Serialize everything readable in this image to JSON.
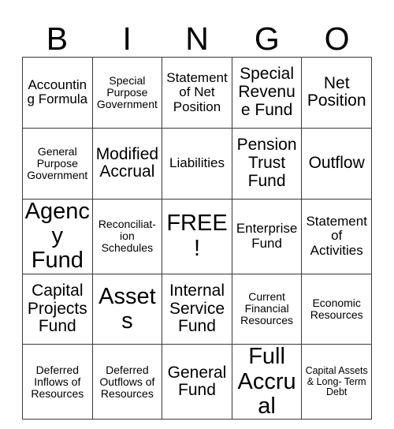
{
  "card": {
    "header_letters": [
      "B",
      "I",
      "N",
      "G",
      "O"
    ],
    "free_space_label": "FREE!",
    "rows": [
      [
        {
          "text": "Accounting Formula",
          "size": "fs-md"
        },
        {
          "text": "Special Purpose Government",
          "size": "fs-sm"
        },
        {
          "text": "Statement of Net Position",
          "size": "fs-md"
        },
        {
          "text": "Special Revenue Fund",
          "size": "fs-lg"
        },
        {
          "text": "Net Position",
          "size": "fs-lg"
        }
      ],
      [
        {
          "text": "General Purpose Government",
          "size": "fs-sm"
        },
        {
          "text": "Modified Accrual",
          "size": "fs-lg"
        },
        {
          "text": "Liabilities",
          "size": "fs-md"
        },
        {
          "text": "Pension Trust Fund",
          "size": "fs-lg"
        },
        {
          "text": "Outflow",
          "size": "fs-lg"
        }
      ],
      [
        {
          "text": "Agency Fund",
          "size": "fs-xl"
        },
        {
          "text": "Reconciliat-\nion\nSchedules",
          "size": "fs-sm"
        },
        {
          "text": "FREE!",
          "size": "fs-xl"
        },
        {
          "text": "Enterprise Fund",
          "size": "fs-md"
        },
        {
          "text": "Statement of Activities",
          "size": "fs-md"
        }
      ],
      [
        {
          "text": "Capital Projects Fund",
          "size": "fs-lg"
        },
        {
          "text": "Assets",
          "size": "fs-xl"
        },
        {
          "text": "Internal Service Fund",
          "size": "fs-lg"
        },
        {
          "text": "Current Financial Resources",
          "size": "fs-sm"
        },
        {
          "text": "Economic Resources",
          "size": "fs-sm"
        }
      ],
      [
        {
          "text": "Deferred Inflows of Resources",
          "size": "fs-sm"
        },
        {
          "text": "Deferred Outflows of Resources",
          "size": "fs-sm"
        },
        {
          "text": "General Fund",
          "size": "fs-lg"
        },
        {
          "text": "Full Accrual",
          "size": "fs-xl"
        },
        {
          "text": "Capital Assets & Long-\nTerm Debt",
          "size": "fs-xs"
        }
      ]
    ],
    "colors": {
      "border": "#3a3a3a",
      "text": "#000000",
      "background": "#ffffff"
    }
  }
}
